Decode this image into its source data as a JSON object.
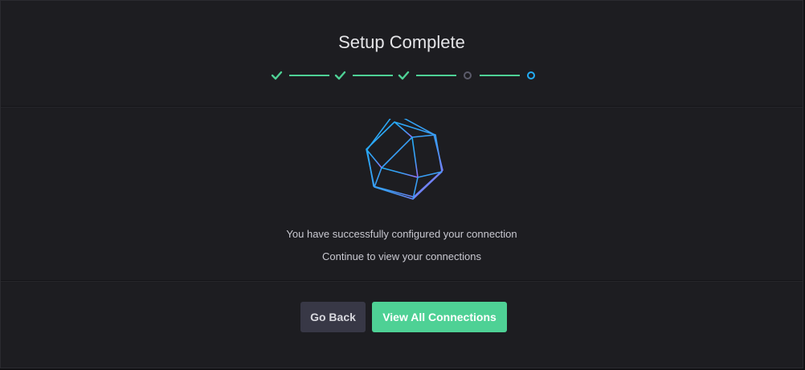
{
  "dialog": {
    "title": "Setup Complete"
  },
  "stepper": {
    "steps": [
      {
        "state": "complete",
        "icon": "check-icon"
      },
      {
        "state": "complete",
        "icon": "check-icon"
      },
      {
        "state": "complete",
        "icon": "check-icon"
      },
      {
        "state": "pending",
        "icon": "circle-icon"
      },
      {
        "state": "current",
        "icon": "circle-icon"
      }
    ],
    "colors": {
      "complete": "#4ed195",
      "pending": "#5b5b6a",
      "current": "#22adf6"
    }
  },
  "content": {
    "graphic_icon": "polyhedron-icon",
    "message_line1": "You have successfully configured your connection",
    "message_line2": "Continue to view your connections"
  },
  "footer": {
    "back_label": "Go Back",
    "view_label": "View All Connections"
  },
  "colors": {
    "accent_green": "#4ed195",
    "accent_blue": "#22adf6",
    "accent_purple": "#9c6cf5",
    "background": "#1d1d21"
  }
}
